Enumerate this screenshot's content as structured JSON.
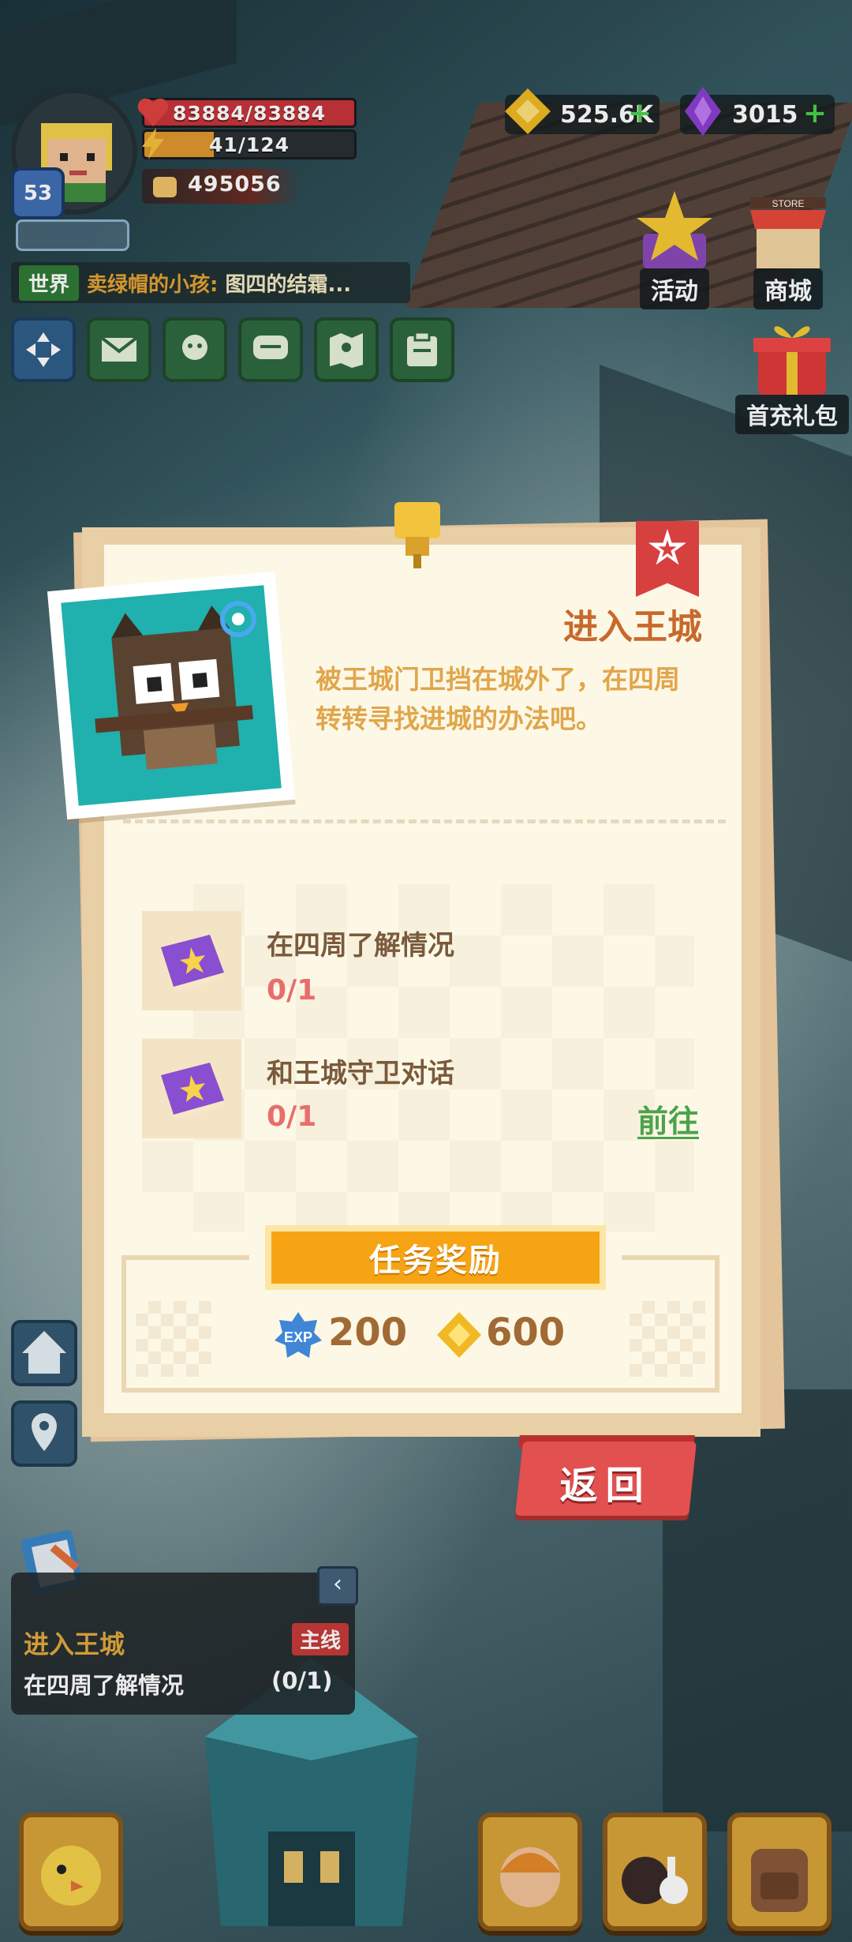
{
  "hud": {
    "level": "53",
    "hp": "83884/83884",
    "energy": "41/124",
    "power": "495056",
    "chat_channel": "世界",
    "chat_sender": "卖绿帽的小孩:",
    "chat_message": "图四的结霜...",
    "gold": "525.6K",
    "gems": "3015",
    "activity_label": "活动",
    "shop_label": "商城",
    "store_sign": "STORE",
    "first_recharge_label": "首充礼包"
  },
  "modal": {
    "title": "进入王城",
    "description": "被王城门卫挡在城外了，在四周转转寻找进城的办法吧。",
    "tasks": [
      {
        "title": "在四周了解情况",
        "progress": "0/1"
      },
      {
        "title": "和王城守卫对话",
        "progress": "0/1"
      }
    ],
    "goto_label": "前往",
    "reward_header": "任务奖励",
    "exp_label": "EXP",
    "exp_reward": "200",
    "gold_reward": "600",
    "back_label": "返回"
  },
  "tracker": {
    "title": "进入王城",
    "tag": "主线",
    "task": "在四周了解情况",
    "progress": "(0/1)"
  },
  "colors": {
    "accent_orange": "#c8692c",
    "reward_yellow": "#f7a414",
    "back_red": "#e25050",
    "goto_green": "#4da24c",
    "progress_red": "#e86d6d"
  }
}
